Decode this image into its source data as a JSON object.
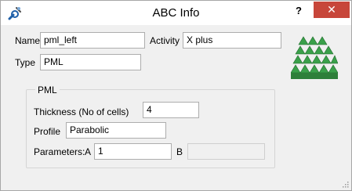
{
  "window": {
    "title": "ABC Info",
    "help_label": "?",
    "close_label": "✕",
    "app_icon": "wrench-gear-icon",
    "close_color": "#c7463a"
  },
  "form": {
    "name_label": "Name",
    "name_value": "pml_left",
    "activity_label": "Activity",
    "activity_value": "X plus",
    "type_label": "Type",
    "type_value": "PML",
    "logo_icon": "green-pyramids-logo",
    "logo_color": "#3aa04a"
  },
  "pml": {
    "group_title": "PML",
    "thickness_label": "Thickness (No of cells)",
    "thickness_value": "4",
    "profile_label": "Profile",
    "profile_value": "Parabolic",
    "parameters_label": "Parameters:",
    "a_label": "A",
    "a_value": "1",
    "b_label": "B",
    "b_value": ""
  }
}
